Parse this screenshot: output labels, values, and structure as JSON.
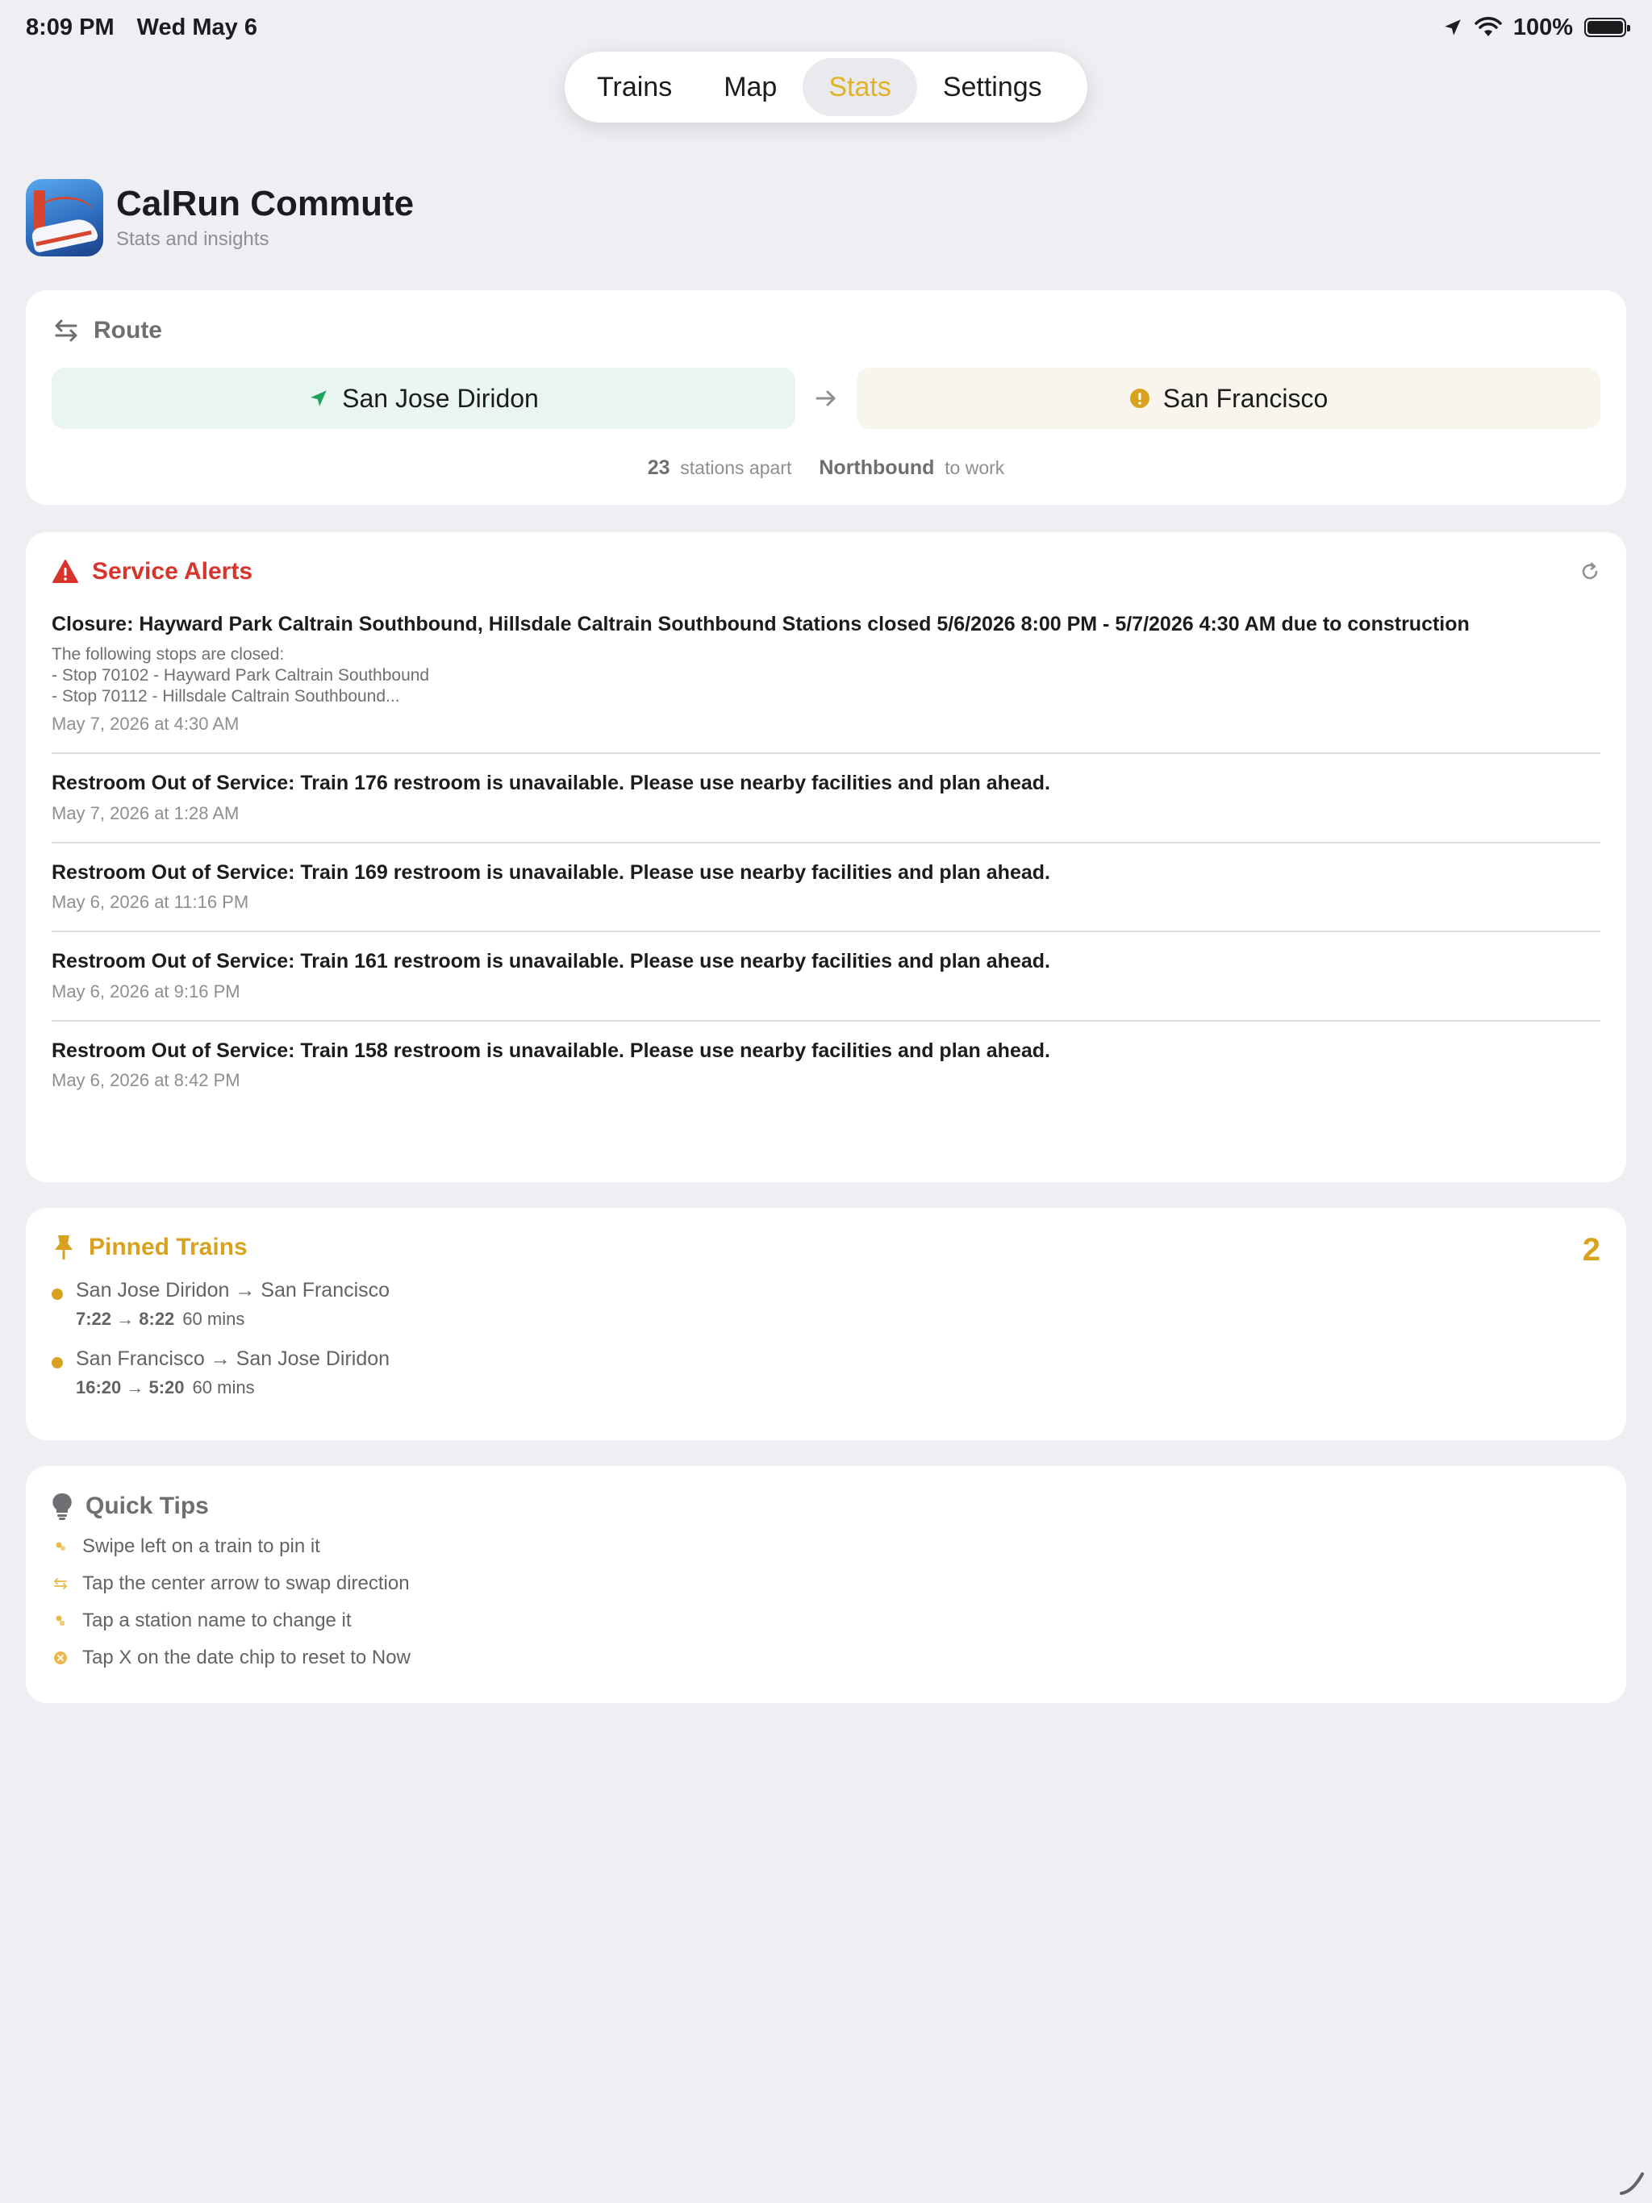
{
  "status_bar": {
    "time": "8:09 PM",
    "date": "Wed May 6",
    "battery": "100%",
    "battery_level": 1.0
  },
  "nav": {
    "tabs": [
      {
        "label": "Trains"
      },
      {
        "label": "Map"
      },
      {
        "label": "Stats"
      },
      {
        "label": "Settings"
      }
    ],
    "active": "Stats",
    "accent_color": "#e3b224"
  },
  "header": {
    "title": "CalRun Commute",
    "subtitle": "Stats and insights",
    "icon": "app-icon-golden-gate-train"
  },
  "route": {
    "heading": "Route",
    "origin": "San Jose Diridon",
    "destination": "San Francisco",
    "stations_apart": "23",
    "stations_apart_label": "stations apart",
    "direction": "Northbound",
    "direction_label": "to work",
    "origin_color": "#1fa25b",
    "destination_color": "#d9a21e"
  },
  "alerts": {
    "heading": "Service Alerts",
    "color": "#d9342b",
    "items": [
      {
        "title": "Closure: Hayward Park Caltrain Southbound, Hillsdale Caltrain Southbound Stations closed 5/6/2026 8:00 PM - 5/7/2026 4:30 AM due to construction",
        "body": "The following stops are closed:\n- Stop 70102 - Hayward Park Caltrain Southbound\n- Stop 70112 - Hillsdale Caltrain Southbound...",
        "time": "May 7, 2026 at 4:30 AM"
      },
      {
        "title": "Restroom Out of Service: Train 176 restroom is unavailable. Please use nearby facilities and plan ahead.",
        "time": "May 7, 2026 at 1:28 AM"
      },
      {
        "title": "Restroom Out of Service: Train 169 restroom is unavailable. Please use nearby facilities and plan ahead.",
        "time": "May 6, 2026 at 11:16 PM"
      },
      {
        "title": "Restroom Out of Service: Train 161 restroom is unavailable. Please use nearby facilities and plan ahead.",
        "time": "May 6, 2026 at 9:16 PM"
      },
      {
        "title": "Restroom Out of Service: Train 158 restroom is unavailable. Please use nearby facilities and plan ahead.",
        "time": "May 6, 2026 at 8:42 PM"
      }
    ]
  },
  "pinned": {
    "heading": "Pinned Trains",
    "count": "2",
    "color": "#d9a21e",
    "items": [
      {
        "route": "San Jose Diridon → San Francisco",
        "times": "7:22 → 8:22",
        "duration": "60 mins"
      },
      {
        "route": "San Francisco → San Jose Diridon",
        "times": "16:20 → 5:20",
        "duration": "60 mins"
      }
    ]
  },
  "tips": {
    "heading": "Quick Tips",
    "items": [
      {
        "text": "Swipe left on a train to pin it",
        "icon": "hand-swipe-icon"
      },
      {
        "text": "Tap the center arrow to swap direction",
        "icon": "swap-arrows-icon"
      },
      {
        "text": "Tap a station name to change it",
        "icon": "hand-tap-icon"
      },
      {
        "text": "Tap X on the date chip to reset to Now",
        "icon": "x-circle-icon"
      }
    ]
  }
}
